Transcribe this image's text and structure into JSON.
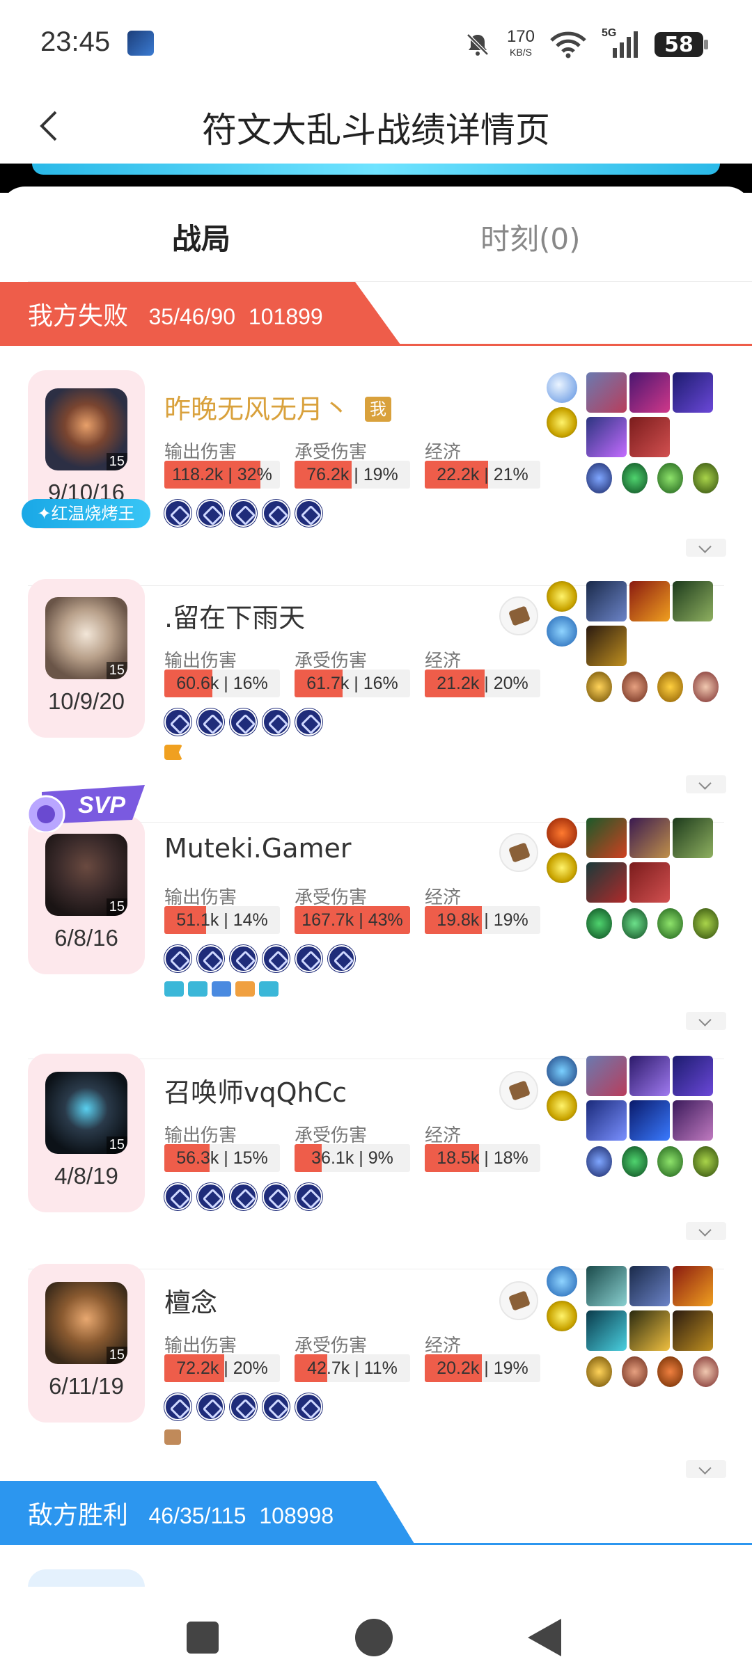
{
  "status": {
    "time": "23:45",
    "net_speed": "170",
    "net_unit": "KB/S",
    "net_type": "5G",
    "battery": "58"
  },
  "header": {
    "title": "符文大乱斗战绩详情页",
    "back_icon": "chevron-left-icon"
  },
  "tabs": [
    {
      "label": "战局",
      "active": true
    },
    {
      "label": "时刻(0)",
      "active": false
    }
  ],
  "colors": {
    "lose": "#ee5d4a",
    "win": "#2c96ef",
    "me": "#d9a13c",
    "rune": "#1f2c7a",
    "bar": "#ee5d4a"
  },
  "stat_labels": {
    "damage": "输出伤害",
    "taken": "承受伤害",
    "gold": "经济"
  },
  "team1": {
    "result": "我方失败",
    "kda": "35/46/90",
    "score": "101899"
  },
  "team2": {
    "result": "敌方胜利",
    "kda": "46/35/115",
    "score": "108998"
  },
  "players": [
    {
      "name": "昨晚无风无月丶",
      "me_tag": "我",
      "kda": "9/10/16",
      "level": "15",
      "badge": "✦红温烧烤王",
      "damage": "118.2k | 32%",
      "damage_pct": 32,
      "taken": "76.2k | 19%",
      "taken_pct": 19,
      "gold": "22.2k | 21%",
      "gold_pct": 21,
      "rune_count": 5
    },
    {
      "name": ".留在下雨天",
      "kda": "10/9/20",
      "level": "15",
      "damage": "60.6k | 16%",
      "damage_pct": 16,
      "taken": "61.7k | 16%",
      "taken_pct": 16,
      "gold": "21.2k | 20%",
      "gold_pct": 20,
      "rune_count": 5
    },
    {
      "name": "Muteki.Gamer",
      "kda": "6/8/16",
      "level": "15",
      "svp": "SVP",
      "damage": "51.1k | 14%",
      "damage_pct": 14,
      "taken": "167.7k | 43%",
      "taken_pct": 43,
      "gold": "19.8k | 19%",
      "gold_pct": 19,
      "rune_count": 6
    },
    {
      "name": "召唤师vqQhCc",
      "kda": "4/8/19",
      "level": "15",
      "damage": "56.3k | 15%",
      "damage_pct": 15,
      "taken": "36.1k | 9%",
      "taken_pct": 9,
      "gold": "18.5k | 18%",
      "gold_pct": 18,
      "rune_count": 5
    },
    {
      "name": "檀念",
      "kda": "6/11/19",
      "level": "15",
      "damage": "72.2k | 20%",
      "damage_pct": 20,
      "taken": "42.7k | 11%",
      "taken_pct": 11,
      "gold": "20.2k | 19%",
      "gold_pct": 19,
      "rune_count": 5
    }
  ]
}
